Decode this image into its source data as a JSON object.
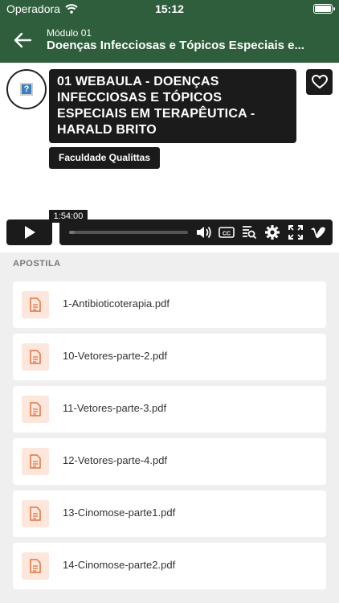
{
  "status": {
    "carrier": "Operadora",
    "time": "15:12"
  },
  "nav": {
    "module": "Módulo 01",
    "title": "Doenças Infecciosas e Tópicos Especiais e..."
  },
  "video": {
    "title": "01 WEBAULA - DOENÇAS INFECCIOSAS E TÓPICOS ESPECIAIS EM TERAPÊUTICA - HARALD BRITO",
    "owner": "Faculdade Qualittas",
    "duration": "1:54:00",
    "progress_fraction": 0.05
  },
  "section": {
    "label": "APOSTILA"
  },
  "files": [
    {
      "name": "1-Antibioticoterapia.pdf"
    },
    {
      "name": "10-Vetores-parte-2.pdf"
    },
    {
      "name": "11-Vetores-parte-3.pdf"
    },
    {
      "name": "12-Vetores-parte-4.pdf"
    },
    {
      "name": "13-Cinomose-parte1.pdf"
    },
    {
      "name": "14-Cinomose-parte2.pdf"
    }
  ],
  "colors": {
    "header_bg": "#2e5e3b",
    "file_icon_bg": "#fde6dc",
    "file_icon_fg": "#e0733e"
  }
}
